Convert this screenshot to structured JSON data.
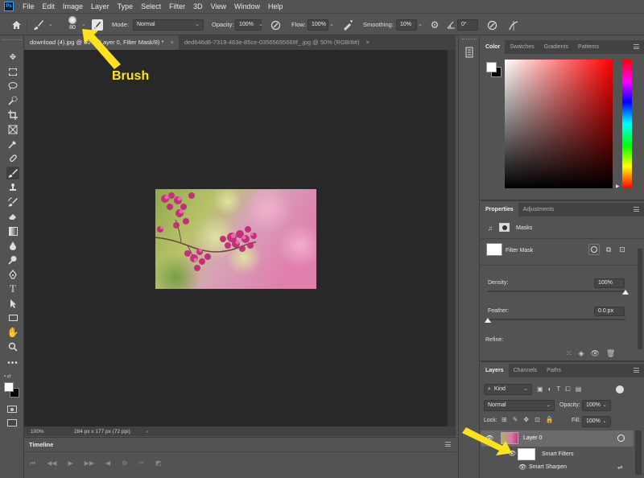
{
  "menubar": {
    "logo": "Ps",
    "items": [
      "File",
      "Edit",
      "Image",
      "Layer",
      "Type",
      "Select",
      "Filter",
      "3D",
      "View",
      "Window",
      "Help"
    ]
  },
  "options": {
    "brush_size": "80",
    "mode_label": "Mode:",
    "mode_value": "Normal",
    "opacity_label": "Opacity:",
    "opacity_value": "100%",
    "flow_label": "Flow:",
    "flow_value": "100%",
    "smoothing_label": "Smoothing:",
    "smoothing_value": "10%",
    "angle_value": "0°"
  },
  "tabs": [
    {
      "label": "download (4).jpg @ 50% (Layer 0, Filter Mask/8) *"
    },
    {
      "label": "ded646d6-7319-483e-85ce-03565695669f_.jpg @ 50% (RGB/8#)"
    }
  ],
  "status": {
    "zoom": "100%",
    "info": "284 px x 177 px (72 ppi)"
  },
  "timeline": {
    "title": "Timeline"
  },
  "annotation": {
    "brush_label": "Brush"
  },
  "color_panel": {
    "tabs": [
      "Color",
      "Swatches",
      "Gradients",
      "Patterns"
    ]
  },
  "properties_panel": {
    "tabs": [
      "Properties",
      "Adjustments"
    ],
    "masks_label": "Masks",
    "filter_mask_label": "Filter Mask",
    "density_label": "Density:",
    "density_value": "100%",
    "density_level": 1.0,
    "feather_label": "Feather:",
    "feather_value": "0.0 px",
    "feather_level": 0.0,
    "refine_label": "Refine:"
  },
  "layers_panel": {
    "tabs": [
      "Layers",
      "Channels",
      "Paths"
    ],
    "kind_value": "Kind",
    "blend_value": "Normal",
    "opacity_label": "Opacity:",
    "opacity_value": "100%",
    "lock_label": "Lock:",
    "fill_label": "Fill:",
    "fill_value": "100%",
    "layers": [
      {
        "name": "Layer 0"
      },
      {
        "name": "Smart Filters"
      },
      {
        "name": "Smart Sharpen"
      }
    ]
  },
  "colors": {
    "app_bg": "#535353",
    "canvas_bg": "#282828",
    "annotation": "#ffe21f",
    "selected_layer": "#6a6a6a"
  }
}
